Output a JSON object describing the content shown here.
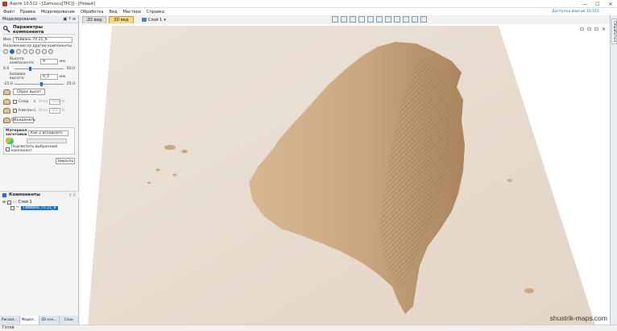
{
  "window": {
    "title": "Aspire 10.512 - [Zamuscu[TPC]] - [Новый]",
    "minimize": "—",
    "maximize": "☐",
    "close": "✕"
  },
  "menu": {
    "items": [
      "Файл",
      "Правка",
      "Моделирование",
      "Обработка",
      "Вид",
      "Мастера",
      "Справка"
    ],
    "update_link": "Доступна версия 10.515"
  },
  "left_panel": {
    "header": "Моделирование",
    "header_buttons": [
      "▣",
      "?",
      "≡"
    ],
    "param_title": "Параметры компонента",
    "name_label": "Имя",
    "name_value": "Тайвань 70 21_6",
    "overlay_label": "Наложение на другие компоненты",
    "height_label": "Высота компонента:",
    "height_value": "9",
    "height_unit": "мм",
    "height_min": "0.0",
    "height_max": "50.0",
    "base_label": "Базовая высота:",
    "base_value": "0_5",
    "base_unit": "мм",
    "base_min": "-25.0",
    "base_max": "25.0",
    "reset_height": "Сброс высот",
    "shape_label": "Спад",
    "shape_angle_label": "Угол",
    "shape_angle_value": "50.0",
    "shape_angle_unit": "%",
    "tilt_label": "Наклон",
    "tilt_angle_label": "Угол",
    "tilt_angle_value": "0.0",
    "tilt_angle_unit": "%",
    "merge_button": "Объединить",
    "material_label": "Материал заготовки",
    "material_value": "Как у исходного",
    "highlight_label": "Подсветить выбранный компонент",
    "close_button": "Закрыть"
  },
  "components": {
    "header": "Компоненты",
    "layer": "Слой 1",
    "item": "Тайвань 70 21_6"
  },
  "bottom_tabs": [
    "Рисова...",
    "Модел...",
    "3D кон...",
    "Слои"
  ],
  "view_tabs": [
    "2D вид",
    "3D вид"
  ],
  "layer_selector": "Слой 1",
  "view_controls": [
    "⊡",
    "⊡",
    "⊡",
    "✕"
  ],
  "right_strip": "Обработка",
  "watermark": "shustrik-maps.com",
  "status": "Готов",
  "colors": {
    "accent": "#1a6fc9",
    "active_tab": "#f7d58a",
    "relief": "#c9a882",
    "wood": "#e8ddd2"
  }
}
